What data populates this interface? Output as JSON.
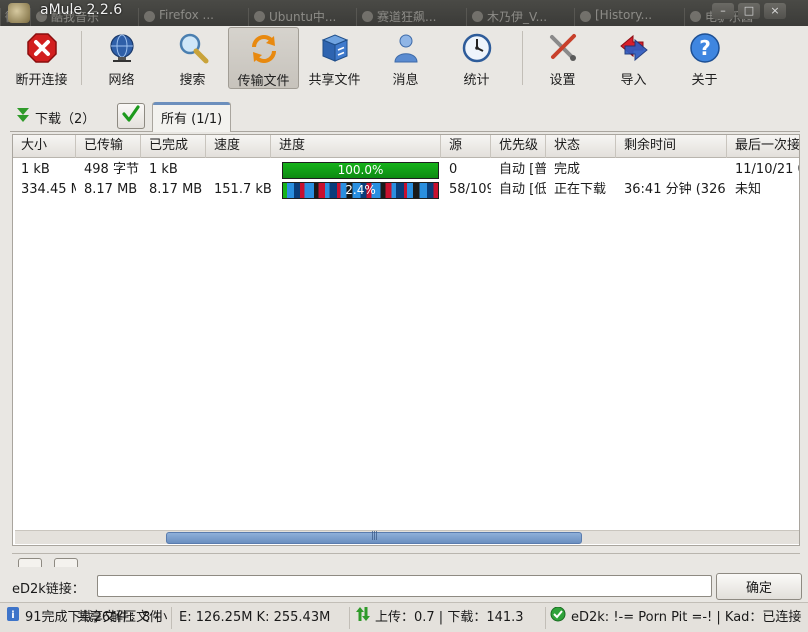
{
  "window": {
    "title": "aMule 2.2.6",
    "background_tabs": [
      "微",
      "酷我音乐",
      "Firefox ...",
      "Ubuntu中...",
      "赛道狂飙...",
      "木乃伊_V...",
      "[History...",
      "电驴乐园"
    ]
  },
  "toolbar": {
    "buttons": [
      {
        "label": "断开连接",
        "icon": "disconnect-icon"
      },
      {
        "label": "网络",
        "icon": "globe-network-icon"
      },
      {
        "label": "搜索",
        "icon": "magnifier-search-icon"
      },
      {
        "label": "传输文件",
        "icon": "transfer-arrows-icon",
        "active": true
      },
      {
        "label": "共享文件",
        "icon": "shared-files-cabinet-icon"
      },
      {
        "label": "消息",
        "icon": "person-messages-icon"
      },
      {
        "label": "统计",
        "icon": "statistics-gauge-icon"
      },
      {
        "label": "设置",
        "icon": "settings-tools-icon"
      },
      {
        "label": "导入",
        "icon": "import-arrows-icon"
      },
      {
        "label": "关于",
        "icon": "help-question-icon"
      }
    ]
  },
  "downloads": {
    "label": "下载（2）",
    "category_tab": "所有 (1/1)",
    "columns": [
      "大小",
      "已传输",
      "已完成",
      "速度",
      "进度",
      "源",
      "优先级",
      "状态",
      "剩余时间",
      "最后一次接"
    ],
    "rows": [
      {
        "size": "1 kB",
        "transferred": "498 字节",
        "completed": "1 kB",
        "speed": "",
        "progress": 100.0,
        "progress_label": "100.0%",
        "sources": "0",
        "priority": "自动 [普",
        "status": "完成",
        "remaining": "",
        "last": "11/10/21 0"
      },
      {
        "size": "334.45 M",
        "transferred": "8.17 MB",
        "completed": "8.17 MB",
        "speed": "151.7 kB",
        "progress": 2.4,
        "progress_label": "2.4%",
        "sources": "58/109",
        "priority": "自动 [低",
        "status": "正在下载",
        "remaining": "36:41 分钟 (326",
        "last": "未知"
      }
    ]
  },
  "ed2k": {
    "label": "eD2k链接：",
    "value": "",
    "confirm_label": "确定"
  },
  "statusbar": {
    "files": "91完成下载26解压文件",
    "files_overlay": "共享文件：8 小",
    "kad_users": "E: 126.25M K: 255.43M",
    "transfer": "上传：0.7 | 下载：141.3",
    "network": "eD2k: !-= Porn Pit =-! | Kad：已连接"
  },
  "colors": {
    "progress_complete": "#16b21a",
    "progress_active_blue": "#2a8fe0",
    "progress_active_red": "#c8102e",
    "accent_tab": "#6c8fbd",
    "scroll_thumb": "#7a9dcc"
  }
}
